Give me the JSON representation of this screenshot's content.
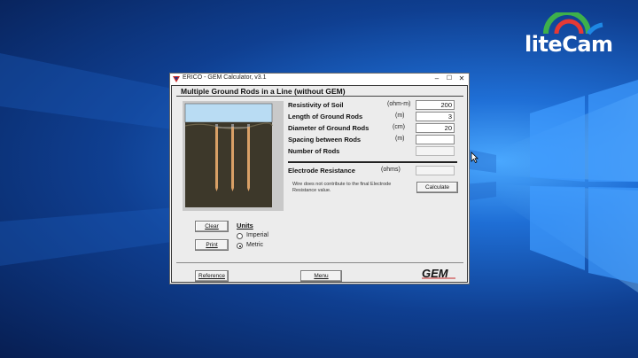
{
  "watermark": {
    "text": "liteCam"
  },
  "window": {
    "title": "ERICO - GEM Calculator, v3.1",
    "controls": {
      "minimize": "–",
      "maximize": "☐",
      "close": "✕"
    }
  },
  "form": {
    "heading": "Multiple Ground Rods in a Line (without GEM)",
    "fields": [
      {
        "label": "Resistivity of Soil",
        "unit": "(ohm-m)",
        "value": "200"
      },
      {
        "label": "Length of Ground Rods",
        "unit": "(m)",
        "value": "3"
      },
      {
        "label": "Diameter of Ground Rods",
        "unit": "(cm)",
        "value": "20"
      },
      {
        "label": "Spacing between Rods",
        "unit": "(m)",
        "value": ""
      },
      {
        "label": "Number of Rods",
        "unit": "",
        "value": ""
      }
    ],
    "result": {
      "label": "Electrode Resistance",
      "unit": "(ohms)",
      "value": ""
    },
    "note": "Wire does not contribute to the final Electrode Resistance value.",
    "calculate_label": "Calculate"
  },
  "actions": {
    "clear_label": "Clear",
    "print_label": "Print",
    "reference_label": "Reference",
    "menu_label": "Menu"
  },
  "units": {
    "title": "Units",
    "options": [
      {
        "label": "Imperial",
        "selected": false
      },
      {
        "label": "Metric",
        "selected": true
      }
    ]
  },
  "logo": {
    "text": "GEM"
  },
  "icons": [
    "app-icon",
    "cursor-icon",
    "ground-rod-diagram"
  ],
  "colors": {
    "desktop_accent": "#1f6fd6",
    "sky": "#b9dcf3",
    "soil": "#3a3528",
    "rod": "#d9a066"
  }
}
